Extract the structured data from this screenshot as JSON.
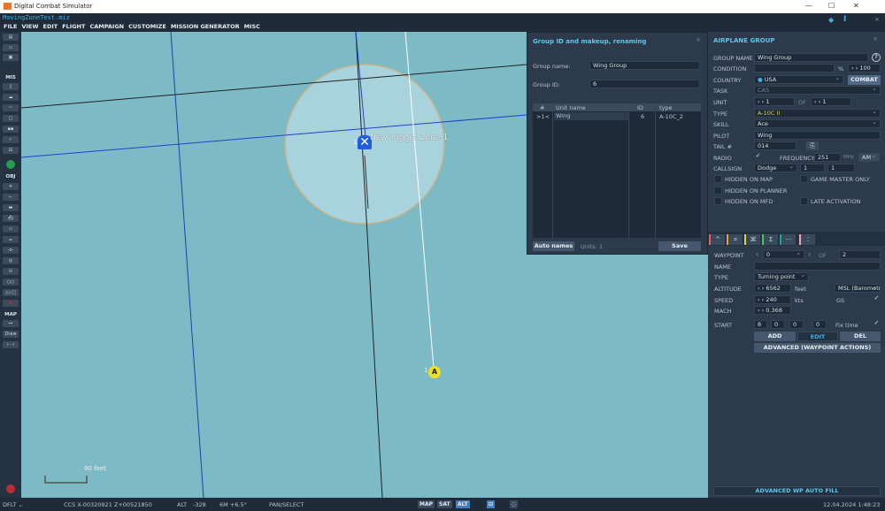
{
  "window": {
    "title": "Digital Combat Simulator",
    "minimize": "—",
    "maximize": "☐",
    "close": "✕"
  },
  "mission_file": "MovingZoneTest.miz",
  "menu": [
    "FILE",
    "VIEW",
    "EDIT",
    "FLIGHT",
    "CAMPAIGN",
    "CUSTOMIZE",
    "MISSION GENERATOR",
    "MISC"
  ],
  "toolbar": {
    "mis_label": "MIS",
    "obj_label": "OBJ",
    "map_label": "MAP",
    "draw_label": "Draw"
  },
  "map": {
    "trigger_zone_label": "New Trigger Zone-1",
    "unit1_number": "1",
    "unit2_number": "1",
    "unit2_letter": "A",
    "scale_label": "90 feet",
    "colors": {
      "water": "#7cbac6",
      "zone": "#a9d3dc"
    }
  },
  "group_dialog": {
    "title": "Group ID and makeup, renaming",
    "close": "×",
    "group_name_label": "Group name:",
    "group_name": "Wing Group",
    "group_id_label": "Group ID:",
    "group_id": "6",
    "columns": [
      "#",
      "Unit name",
      "ID",
      "type"
    ],
    "rows": [
      {
        "num": ">1<",
        "name": "Wing",
        "id": "6",
        "type": "A-10C_2"
      }
    ],
    "auto_names": "Auto names",
    "units_count": "Units: 1",
    "save": "Save"
  },
  "airplane_group": {
    "title": "AIRPLANE GROUP",
    "close": "×",
    "group_name_label": "GROUP NAME",
    "group_name": "Wing Group",
    "help": "?",
    "condition_label": "CONDITION",
    "condition": "",
    "percent": "%",
    "condition_value": "100",
    "country_label": "COUNTRY",
    "country": "USA",
    "combat": "COMBAT",
    "task_label": "TASK",
    "task": "CAS",
    "unit_label": "UNIT",
    "unit": "1",
    "of_label": "OF",
    "unit_of": "1",
    "type_label": "TYPE",
    "type": "A-10C II",
    "skill_label": "SKILL",
    "skill": "Ace",
    "pilot_label": "PILOT",
    "pilot": "Wing",
    "tail_label": "TAIL #",
    "tail": "014",
    "radio_label": "RADIO",
    "radio_checked": true,
    "frequency_label": "FREQUENCY",
    "frequency": "251",
    "mhz": "MHz",
    "modulation": "AM",
    "callsign_label": "CALLSIGN",
    "callsign": "Dodge",
    "callsign_n1": "1",
    "callsign_n2": "1",
    "hidden_on_map": "HIDDEN ON MAP",
    "game_master_only": "GAME MASTER ONLY",
    "hidden_on_planner": "HIDDEN ON PLANNER",
    "hidden_on_mfd": "HIDDEN ON MFD",
    "late_activation": "LATE ACTIVATION"
  },
  "waypoint": {
    "tab_colors": [
      "#e8605a",
      "#e8a030",
      "#e0d040",
      "#50c060",
      "#20a0a0",
      "#f0a0b0"
    ],
    "waypoint_label": "WAYPOINT",
    "waypoint": "0",
    "of_label": "OF",
    "waypoint_of": "2",
    "name_label": "NAME",
    "name": "",
    "type_label": "TYPE",
    "type": "Turning point",
    "altitude_label": "ALTITUDE",
    "altitude": "6562",
    "altitude_unit": "feet",
    "altitude_ref": "MSL (Barometric)",
    "speed_label": "SPEED",
    "speed": "240",
    "speed_unit": "kts",
    "gs_label": "GS",
    "mach_label": "MACH",
    "mach": "0.368",
    "start_label": "START",
    "start_d": "8",
    "start_h": "0",
    "start_m": "0",
    "start_s": "0",
    "fix_time": "Fix time",
    "add": "ADD",
    "edit": "EDIT",
    "del": "DEL",
    "advanced": "ADVANCED (WAYPOINT ACTIONS)",
    "auto_fill": "ADVANCED WP AUTO FILL"
  },
  "status": {
    "layer": "DFLT",
    "coords": "CCS  X-00320921 Z+00521850",
    "alt_label": "ALT",
    "alt": "-328",
    "mag": "6M  +6.5°",
    "mode": "PAN/SELECT",
    "map_btn": "MAP",
    "sat_btn": "SAT",
    "alt_btn": "ALT",
    "datetime": "12.04.2024 1:48:23"
  }
}
